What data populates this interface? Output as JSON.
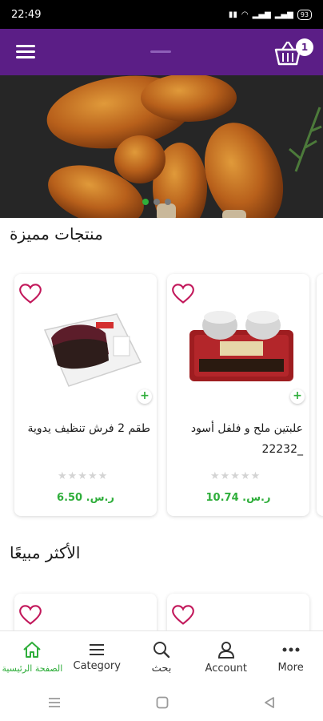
{
  "status_bar": {
    "time": "22:49",
    "battery": "93",
    "network": "LTE"
  },
  "header": {
    "cart_count": "1",
    "menu_icon": "hamburger-icon",
    "cart_icon": "basket-icon"
  },
  "hero": {
    "slide_count": 3,
    "active_slide": 0,
    "alt": "grilled chicken legs"
  },
  "featured": {
    "title": "منتجات مميزة",
    "products": [
      {
        "name": "علبتين ملح و فلفل أسود _22232",
        "price": "10.74 .ر.س",
        "rating": 0
      },
      {
        "name": "طقم 2 فرش تنظيف يدوية",
        "price": "6.50 .ر.س",
        "rating": 0
      }
    ]
  },
  "best_sellers": {
    "title": "الأكثر مبيعًا"
  },
  "bottom_nav": {
    "items": [
      {
        "label": "More",
        "icon": "more-dots-icon"
      },
      {
        "label": "Account",
        "icon": "person-icon"
      },
      {
        "label": "بحث",
        "icon": "search-icon"
      },
      {
        "label": "Category",
        "icon": "list-icon"
      },
      {
        "label": "الصفحة الرئيسية",
        "icon": "home-icon"
      }
    ]
  },
  "colors": {
    "primary": "#5b1e86",
    "accent": "#2fae3b",
    "heart": "#c2185b"
  }
}
